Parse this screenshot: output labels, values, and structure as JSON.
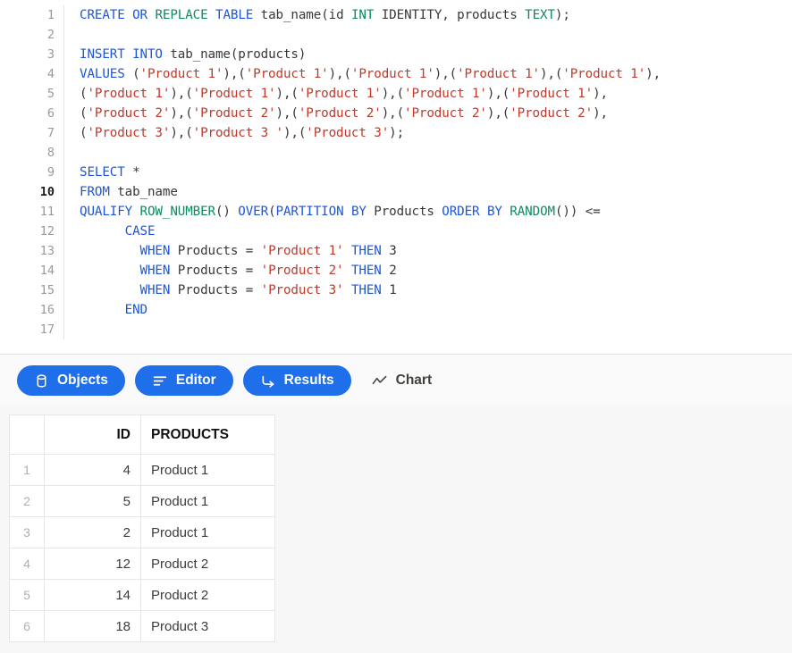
{
  "editor": {
    "active_line": 10,
    "line_numbers": [
      1,
      2,
      3,
      4,
      5,
      6,
      7,
      8,
      9,
      10,
      11,
      12,
      13,
      14,
      15,
      16,
      17
    ],
    "lines": [
      {
        "n": 1,
        "text": "CREATE OR REPLACE TABLE tab_name(id INT IDENTITY, products TEXT);"
      },
      {
        "n": 2,
        "text": ""
      },
      {
        "n": 3,
        "text": "INSERT INTO tab_name(products)"
      },
      {
        "n": 4,
        "text": "VALUES ('Product 1'),('Product 1'),('Product 1'),('Product 1'),('Product 1'),"
      },
      {
        "n": 5,
        "text": "('Product 1'),('Product 1'),('Product 1'),('Product 1'),('Product 1'),"
      },
      {
        "n": 6,
        "text": "('Product 2'),('Product 2'),('Product 2'),('Product 2'),('Product 2'),"
      },
      {
        "n": 7,
        "text": "('Product 3'),('Product 3 '),('Product 3');"
      },
      {
        "n": 8,
        "text": ""
      },
      {
        "n": 9,
        "text": "SELECT *"
      },
      {
        "n": 10,
        "text": "FROM tab_name"
      },
      {
        "n": 11,
        "text": "QUALIFY ROW_NUMBER() OVER(PARTITION BY Products ORDER BY RANDOM()) <="
      },
      {
        "n": 12,
        "text": "      CASE"
      },
      {
        "n": 13,
        "text": "        WHEN Products = 'Product 1' THEN 3"
      },
      {
        "n": 14,
        "text": "        WHEN Products = 'Product 2' THEN 2"
      },
      {
        "n": 15,
        "text": "        WHEN Products = 'Product 3' THEN 1"
      },
      {
        "n": 16,
        "text": "      END"
      },
      {
        "n": 17,
        "text": ""
      }
    ],
    "tokens": [
      [
        {
          "t": "CREATE",
          "c": "kw"
        },
        {
          "t": " ",
          "c": "pl"
        },
        {
          "t": "OR",
          "c": "kw"
        },
        {
          "t": " ",
          "c": "pl"
        },
        {
          "t": "REPLACE",
          "c": "kw2"
        },
        {
          "t": " ",
          "c": "pl"
        },
        {
          "t": "TABLE",
          "c": "kw"
        },
        {
          "t": " tab_name(id ",
          "c": "pl"
        },
        {
          "t": "INT",
          "c": "kw2"
        },
        {
          "t": " IDENTITY, products ",
          "c": "pl"
        },
        {
          "t": "TEXT",
          "c": "kw2"
        },
        {
          "t": ");",
          "c": "pl"
        }
      ],
      [],
      [
        {
          "t": "INSERT",
          "c": "kw"
        },
        {
          "t": " ",
          "c": "pl"
        },
        {
          "t": "INTO",
          "c": "kw"
        },
        {
          "t": " tab_name(products)",
          "c": "pl"
        }
      ],
      [
        {
          "t": "VALUES",
          "c": "kw"
        },
        {
          "t": " (",
          "c": "pl"
        },
        {
          "t": "'Product 1'",
          "c": "str"
        },
        {
          "t": "),(",
          "c": "pl"
        },
        {
          "t": "'Product 1'",
          "c": "str"
        },
        {
          "t": "),(",
          "c": "pl"
        },
        {
          "t": "'Product 1'",
          "c": "str"
        },
        {
          "t": "),(",
          "c": "pl"
        },
        {
          "t": "'Product 1'",
          "c": "str"
        },
        {
          "t": "),(",
          "c": "pl"
        },
        {
          "t": "'Product 1'",
          "c": "str"
        },
        {
          "t": "),",
          "c": "pl"
        }
      ],
      [
        {
          "t": "(",
          "c": "pl"
        },
        {
          "t": "'Product 1'",
          "c": "str"
        },
        {
          "t": "),(",
          "c": "pl"
        },
        {
          "t": "'Product 1'",
          "c": "str"
        },
        {
          "t": "),(",
          "c": "pl"
        },
        {
          "t": "'Product 1'",
          "c": "str"
        },
        {
          "t": "),(",
          "c": "pl"
        },
        {
          "t": "'Product 1'",
          "c": "str"
        },
        {
          "t": "),(",
          "c": "pl"
        },
        {
          "t": "'Product 1'",
          "c": "str"
        },
        {
          "t": "),",
          "c": "pl"
        }
      ],
      [
        {
          "t": "(",
          "c": "pl"
        },
        {
          "t": "'Product 2'",
          "c": "str"
        },
        {
          "t": "),(",
          "c": "pl"
        },
        {
          "t": "'Product 2'",
          "c": "str"
        },
        {
          "t": "),(",
          "c": "pl"
        },
        {
          "t": "'Product 2'",
          "c": "str"
        },
        {
          "t": "),(",
          "c": "pl"
        },
        {
          "t": "'Product 2'",
          "c": "str"
        },
        {
          "t": "),(",
          "c": "pl"
        },
        {
          "t": "'Product 2'",
          "c": "str"
        },
        {
          "t": "),",
          "c": "pl"
        }
      ],
      [
        {
          "t": "(",
          "c": "pl"
        },
        {
          "t": "'Product 3'",
          "c": "str"
        },
        {
          "t": "),(",
          "c": "pl"
        },
        {
          "t": "'Product 3 '",
          "c": "str"
        },
        {
          "t": "),(",
          "c": "pl"
        },
        {
          "t": "'Product 3'",
          "c": "str"
        },
        {
          "t": ");",
          "c": "pl"
        }
      ],
      [],
      [
        {
          "t": "SELECT",
          "c": "kw"
        },
        {
          "t": " *",
          "c": "pl"
        }
      ],
      [
        {
          "t": "FROM",
          "c": "kw"
        },
        {
          "t": " tab_name",
          "c": "pl"
        }
      ],
      [
        {
          "t": "QUALIFY",
          "c": "kw"
        },
        {
          "t": " ",
          "c": "pl"
        },
        {
          "t": "ROW_NUMBER",
          "c": "kw2"
        },
        {
          "t": "() ",
          "c": "pl"
        },
        {
          "t": "OVER",
          "c": "kw"
        },
        {
          "t": "(",
          "c": "pl"
        },
        {
          "t": "PARTITION",
          "c": "kw"
        },
        {
          "t": " ",
          "c": "pl"
        },
        {
          "t": "BY",
          "c": "kw"
        },
        {
          "t": " Products ",
          "c": "pl"
        },
        {
          "t": "ORDER",
          "c": "kw"
        },
        {
          "t": " ",
          "c": "pl"
        },
        {
          "t": "BY",
          "c": "kw"
        },
        {
          "t": " ",
          "c": "pl"
        },
        {
          "t": "RANDOM",
          "c": "kw2"
        },
        {
          "t": "()) <=",
          "c": "pl"
        }
      ],
      [
        {
          "t": "      ",
          "c": "pl"
        },
        {
          "t": "CASE",
          "c": "kw"
        }
      ],
      [
        {
          "t": "        ",
          "c": "pl"
        },
        {
          "t": "WHEN",
          "c": "kw"
        },
        {
          "t": " Products = ",
          "c": "pl"
        },
        {
          "t": "'Product 1'",
          "c": "str"
        },
        {
          "t": " ",
          "c": "pl"
        },
        {
          "t": "THEN",
          "c": "kw"
        },
        {
          "t": " ",
          "c": "pl"
        },
        {
          "t": "3",
          "c": "num"
        }
      ],
      [
        {
          "t": "        ",
          "c": "pl"
        },
        {
          "t": "WHEN",
          "c": "kw"
        },
        {
          "t": " Products = ",
          "c": "pl"
        },
        {
          "t": "'Product 2'",
          "c": "str"
        },
        {
          "t": " ",
          "c": "pl"
        },
        {
          "t": "THEN",
          "c": "kw"
        },
        {
          "t": " ",
          "c": "pl"
        },
        {
          "t": "2",
          "c": "num"
        }
      ],
      [
        {
          "t": "        ",
          "c": "pl"
        },
        {
          "t": "WHEN",
          "c": "kw"
        },
        {
          "t": " Products = ",
          "c": "pl"
        },
        {
          "t": "'Product 3'",
          "c": "str"
        },
        {
          "t": " ",
          "c": "pl"
        },
        {
          "t": "THEN",
          "c": "kw"
        },
        {
          "t": " ",
          "c": "pl"
        },
        {
          "t": "1",
          "c": "num"
        }
      ],
      [
        {
          "t": "      ",
          "c": "pl"
        },
        {
          "t": "END",
          "c": "kw"
        }
      ],
      []
    ]
  },
  "tabs": [
    {
      "label": "Objects",
      "icon": "database-icon",
      "active": true
    },
    {
      "label": "Editor",
      "icon": "list-lines-icon",
      "active": true
    },
    {
      "label": "Results",
      "icon": "arrow-turn-icon",
      "active": true
    },
    {
      "label": "Chart",
      "icon": "line-chart-icon",
      "active": false
    }
  ],
  "results": {
    "columns": [
      "",
      "ID",
      "PRODUCTS"
    ],
    "rows": [
      {
        "idx": "1",
        "id": "4",
        "products": "Product 1"
      },
      {
        "idx": "2",
        "id": "5",
        "products": "Product 1"
      },
      {
        "idx": "3",
        "id": "2",
        "products": "Product 1"
      },
      {
        "idx": "4",
        "id": "12",
        "products": "Product 2"
      },
      {
        "idx": "5",
        "id": "14",
        "products": "Product 2"
      },
      {
        "idx": "6",
        "id": "18",
        "products": "Product 3"
      }
    ]
  },
  "colors": {
    "accent": "#1f6feb",
    "keyword": "#1a56db",
    "type_function": "#0b8a5f",
    "string": "#c0392b",
    "plain_text": "#383838",
    "gutter_text": "#999999",
    "results_bg": "#f7f7f7"
  }
}
